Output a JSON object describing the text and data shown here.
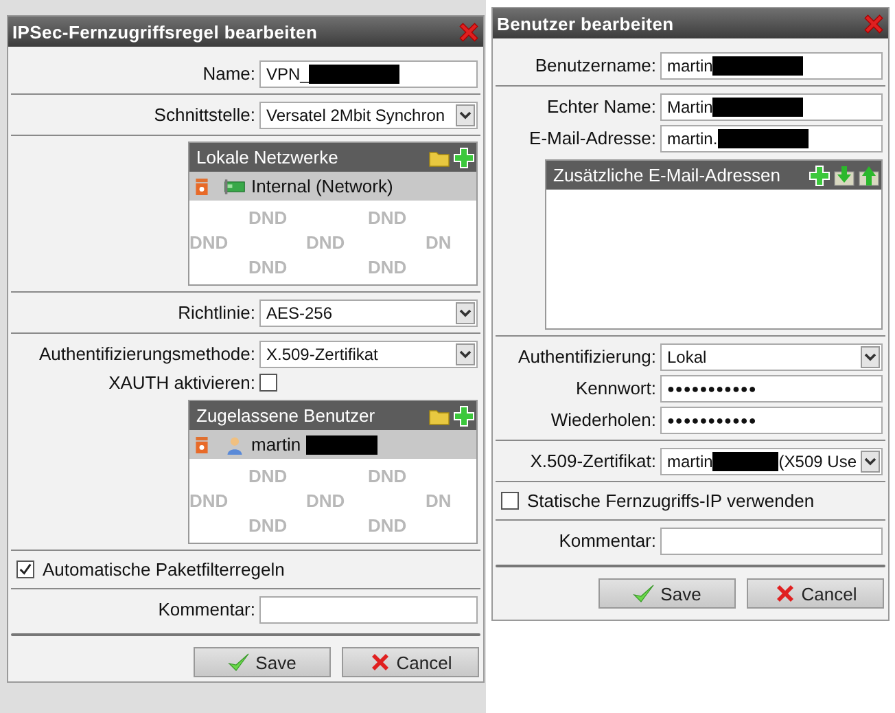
{
  "dialogs": [
    {
      "title": "IPSec-Fernzugriffsregel bearbeiten",
      "rows": [
        {
          "kind": "field",
          "label": "Name:",
          "value": "VPN_",
          "redacted": true
        },
        {
          "kind": "divider"
        },
        {
          "kind": "select",
          "label": "Schnittstelle:",
          "value": "Versatel 2Mbit Synchron"
        },
        {
          "kind": "divider"
        },
        {
          "kind": "list",
          "title": "Lokale Netzwerke",
          "tools": [
            {
              "kind": "folder"
            },
            {
              "kind": "add"
            }
          ],
          "items": [
            {
              "kind": "network",
              "text": "Internal (Network)",
              "redacted": false,
              "selected": true
            }
          ],
          "drop_hints": [
            "DND",
            "DND",
            "DND",
            "DND",
            "DN",
            "DND",
            "DND"
          ]
        },
        {
          "kind": "divider"
        },
        {
          "kind": "select",
          "label": "Richtlinie:",
          "value": "AES-256"
        },
        {
          "kind": "divider"
        },
        {
          "kind": "select",
          "label": "Authentifizierungsmethode:",
          "value": "X.509-Zertifikat"
        },
        {
          "kind": "check_field",
          "label": "XAUTH aktivieren:",
          "checked": false
        },
        {
          "kind": "list",
          "title": "Zugelassene Benutzer",
          "tools": [
            {
              "kind": "folder"
            },
            {
              "kind": "add"
            }
          ],
          "items": [
            {
              "kind": "user",
              "text": "martin",
              "redacted": true,
              "selected": true
            }
          ],
          "drop_hints": [
            "DND",
            "DND",
            "DND",
            "DND",
            "DN",
            "DND",
            "DND"
          ]
        },
        {
          "kind": "divider"
        },
        {
          "kind": "checkbox",
          "label": "Automatische Paketfilterregeln",
          "checked": true
        },
        {
          "kind": "divider"
        },
        {
          "kind": "field",
          "label": "Kommentar:",
          "value": ""
        },
        {
          "kind": "rule"
        }
      ],
      "buttons": [
        {
          "kind": "save",
          "label": "Save"
        },
        {
          "kind": "cancel",
          "label": "Cancel"
        }
      ]
    },
    {
      "title": "Benutzer bearbeiten",
      "rows": [
        {
          "kind": "field",
          "label": "Benutzername:",
          "value": "martin",
          "redacted": true
        },
        {
          "kind": "divider"
        },
        {
          "kind": "field",
          "label": "Echter Name:",
          "value": "Martin",
          "redacted": true
        },
        {
          "kind": "field",
          "label": "E-Mail-Adresse:",
          "value": "martin.",
          "redacted": true
        },
        {
          "kind": "list",
          "title": "Zusätzliche E-Mail-Adressen",
          "tools": [
            {
              "kind": "add"
            },
            {
              "kind": "import"
            },
            {
              "kind": "export"
            }
          ],
          "items": []
        },
        {
          "kind": "divider"
        },
        {
          "kind": "select",
          "label": "Authentifizierung:",
          "value": "Lokal"
        },
        {
          "kind": "password",
          "label": "Kennwort:",
          "value": "●●●●●●●●●●●"
        },
        {
          "kind": "password",
          "label": "Wiederholen:",
          "value": "●●●●●●●●●●●"
        },
        {
          "kind": "divider"
        },
        {
          "kind": "select",
          "label": "X.509-Zertifikat:",
          "value": "martin",
          "redacted": true,
          "value_after": "(X509 Use"
        },
        {
          "kind": "divider"
        },
        {
          "kind": "checkbox",
          "label": "Statische Fernzugriffs-IP verwenden",
          "checked": false
        },
        {
          "kind": "divider"
        },
        {
          "kind": "field",
          "label": "Kommentar:",
          "value": ""
        },
        {
          "kind": "rule"
        }
      ],
      "buttons": [
        {
          "kind": "save",
          "label": "Save"
        },
        {
          "kind": "cancel",
          "label": "Cancel"
        }
      ]
    }
  ]
}
